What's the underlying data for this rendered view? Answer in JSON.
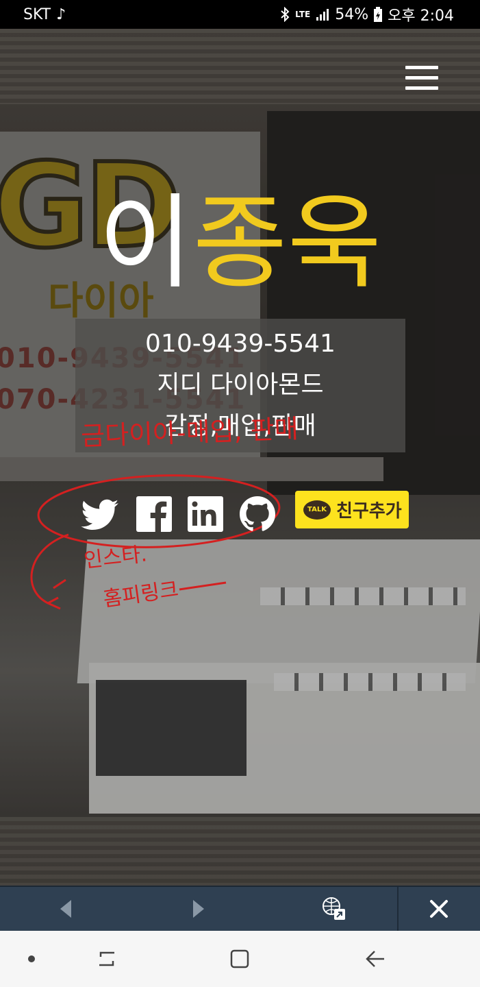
{
  "status_bar": {
    "carrier": "SKT",
    "music_icon": "music-note-icon",
    "network": "LTE",
    "battery": "54%",
    "time": "오후 2:04"
  },
  "profile": {
    "name_first": "이",
    "name_rest": "종욱",
    "phone": "010-9439-5541",
    "business": "지디 다이아몬드",
    "services": "감정,매입,판매"
  },
  "annotations": {
    "text1": "금다이아-매입, 판매",
    "text2": "인스타.",
    "text3": "홈피링크"
  },
  "social": {
    "icons": [
      "twitter-icon",
      "facebook-icon",
      "linkedin-icon",
      "github-icon"
    ],
    "kakao_badge": "TALK",
    "kakao_label": "친구추가"
  },
  "background_sign": {
    "logo": "GD",
    "sub": "다이아",
    "phone1": "010-9439-5541",
    "phone2": "070-4231-5541"
  },
  "colors": {
    "accent_yellow": "#f1ca1e",
    "kakao_yellow": "#fde21e",
    "annotation_red": "#d42020",
    "toolbar": "#2f4052"
  }
}
